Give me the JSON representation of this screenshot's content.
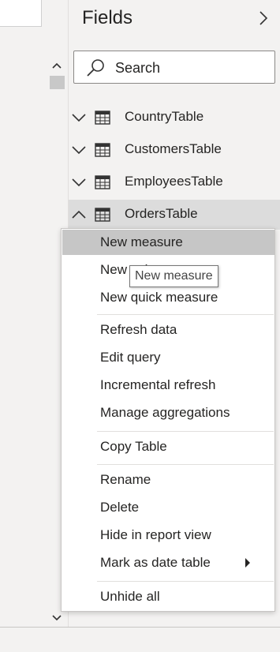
{
  "fields_pane": {
    "title": "Fields",
    "collapse_icon": "chevron-right-icon",
    "search": {
      "placeholder": "Search",
      "value": ""
    },
    "tables": [
      {
        "name": "CountryTable",
        "expanded": false
      },
      {
        "name": "CustomersTable",
        "expanded": false
      },
      {
        "name": "EmployeesTable",
        "expanded": false
      },
      {
        "name": "OrdersTable",
        "expanded": true
      }
    ]
  },
  "context_menu": {
    "groups": [
      [
        {
          "label": "New measure",
          "highlighted": true
        },
        {
          "label": "New column"
        },
        {
          "label": "New quick measure"
        }
      ],
      [
        {
          "label": "Refresh data"
        },
        {
          "label": "Edit query"
        },
        {
          "label": "Incremental refresh"
        },
        {
          "label": "Manage aggregations"
        }
      ],
      [
        {
          "label": "Copy Table"
        }
      ],
      [
        {
          "label": "Rename"
        },
        {
          "label": "Delete"
        },
        {
          "label": "Hide in report view"
        },
        {
          "label": "Mark as date table",
          "has_submenu": true
        }
      ],
      [
        {
          "label": "Unhide all"
        }
      ]
    ]
  },
  "tooltip": {
    "text": "New measure"
  },
  "colors": {
    "pane_bg": "#f3f2f1",
    "highlight": "#c6c6c6",
    "expanded_row": "#dcdcdc"
  }
}
